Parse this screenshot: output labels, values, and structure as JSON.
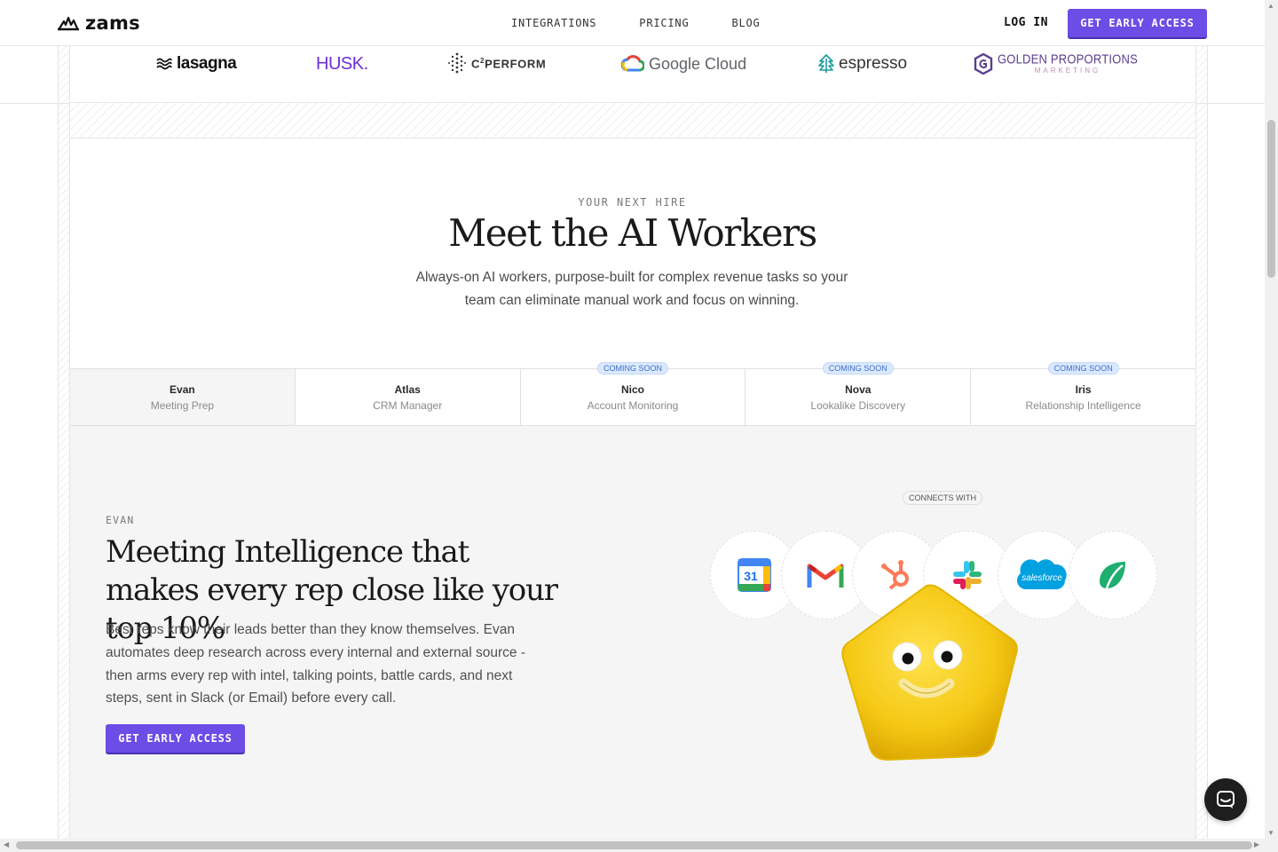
{
  "nav": {
    "logo_text": "zams",
    "links": [
      "INTEGRATIONS",
      "PRICING",
      "BLOG"
    ],
    "login": "LOG IN",
    "cta": "GET EARLY ACCESS"
  },
  "logos": {
    "lasagna": "lasagna",
    "husk": "HUSK.",
    "c2perform_c": "C",
    "c2perform_sup": "2",
    "c2perform_rest": "PERFORM",
    "google_cloud": "Google Cloud",
    "espresso": "espresso",
    "golden_line1": "GOLDEN PROPORTIONS",
    "golden_line2": "MARKETING"
  },
  "hero": {
    "eyebrow": "YOUR NEXT HIRE",
    "title": "Meet the AI Workers",
    "subtitle": "Always-on AI workers, purpose-built for complex revenue tasks so your team can eliminate manual work and focus on winning."
  },
  "tabs": [
    {
      "name": "Evan",
      "role": "Meeting Prep",
      "badge": ""
    },
    {
      "name": "Atlas",
      "role": "CRM Manager",
      "badge": ""
    },
    {
      "name": "Nico",
      "role": "Account Monitoring",
      "badge": "COMING SOON"
    },
    {
      "name": "Nova",
      "role": "Lookalike Discovery",
      "badge": "COMING SOON"
    },
    {
      "name": "Iris",
      "role": "Relationship Intelligence",
      "badge": "COMING SOON"
    }
  ],
  "worker": {
    "eyebrow": "EVAN",
    "title": "Meeting Intelligence that makes every rep close like your top 10%",
    "description": "Best reps know their leads better than they know themselves. Evan automates deep research across every internal and external source - then arms every rep with intel, talking points, battle cards, and next steps, sent in Slack (or Email) before every call.",
    "cta": "GET EARLY ACCESS"
  },
  "integrations": {
    "label": "CONNECTS WITH",
    "calendar_day": "31",
    "salesforce": "salesforce",
    "icons": [
      "google-calendar-icon",
      "gmail-icon",
      "hubspot-icon",
      "slack-icon",
      "salesforce-icon",
      "gong-icon"
    ]
  },
  "colors": {
    "accent": "#6c4de6",
    "panel_bg": "#f5f5f5",
    "badge_bg": "#dbe9ff"
  }
}
